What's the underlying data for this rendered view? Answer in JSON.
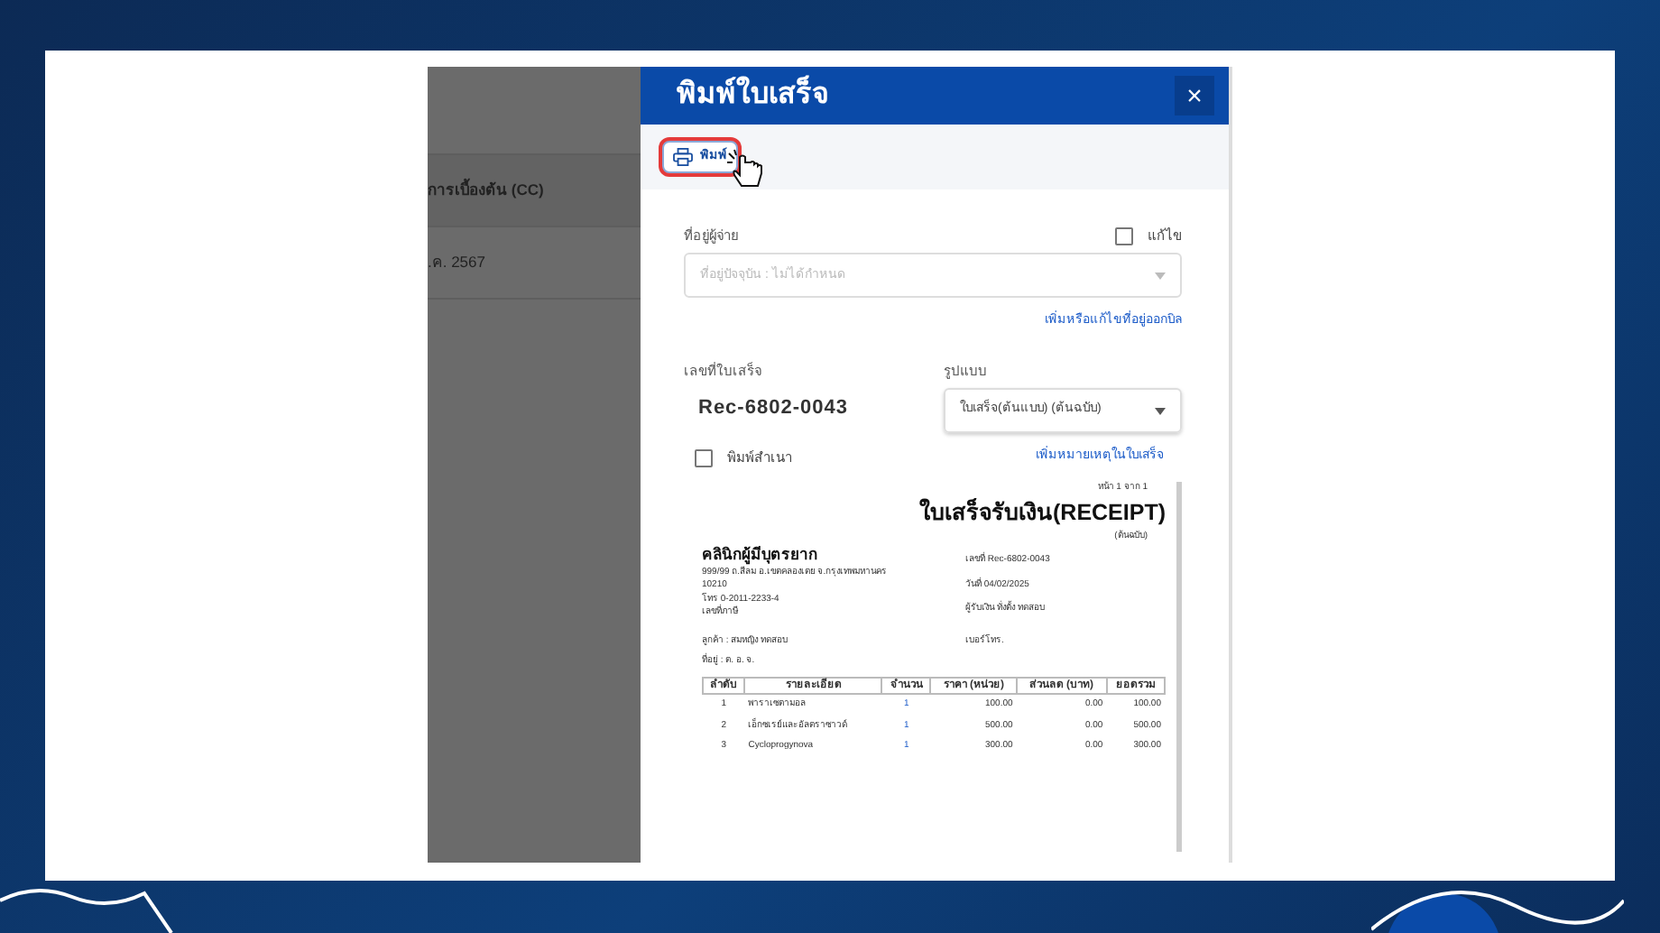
{
  "background_app": {
    "rows": [
      {
        "text": "การเบื้องต้น (CC)",
        "bold": true
      },
      {
        "text": ".ค. 2567",
        "bold": false
      }
    ]
  },
  "dialog": {
    "title": "พิมพ์ใบเสร็จ",
    "close": "×",
    "print_button": "พิมพ์",
    "payer_address": {
      "label": "ที่อยู่ผู้จ่าย",
      "edit": {
        "label": "แก้ไข",
        "checked": false
      },
      "placeholder": "ที่อยู่ปัจจุบัน : ไม่ได้กำหนด",
      "link": "เพิ่มหรือแก้ไขที่อยู่ออกบิล"
    },
    "receipt_no": {
      "label": "เลขที่ใบเสร็จ",
      "value": "Rec-6802-0043"
    },
    "format": {
      "label": "รูปแบบ",
      "value": "ใบเสร็จ(ต้นแบบ) (ต้นฉบับ)"
    },
    "print_copy": {
      "label": "พิมพ์สำเนา",
      "checked": false
    },
    "note_link": "เพิ่มหมายเหตุในใบเสร็จ",
    "preview": {
      "page": "หน้า 1 จาก 1",
      "title": "ใบเสร็จรับเงิน(RECEIPT)",
      "subtitle": "(ต้นฉบับ)",
      "clinic": "คลินิกผู้มีบุตรยาก",
      "address_lines": [
        "999/99 ถ.สีลม อ.เขตคลองเตย จ.กรุงเทพมหานคร",
        "10210",
        "โทร 0-2011-2233-4",
        "เลขที่ภาษี"
      ],
      "meta": [
        "เลขที่ Rec-6802-0043",
        "วันที่ 04/02/2025",
        "ผู้รับเงิน ทั่งตั้ง ทดสอบ"
      ],
      "customer": "ลูกค้า :  สมหญิง ทดสอบ",
      "phone": "เบอร์โทร.",
      "address": "ที่อยู่ :   ต. อ. จ.",
      "columns": [
        "ลำดับ",
        "รายละเอียด",
        "จำนวน",
        "ราคา (หน่วย)",
        "ส่วนลด (บาท)",
        "ยอดรวม"
      ],
      "rows": [
        [
          "1",
          "พาราเซตามอล",
          "1",
          "100.00",
          "0.00",
          "100.00"
        ],
        [
          "2",
          "เอ็กซเรย์และอัลตราซาวด์",
          "1",
          "500.00",
          "0.00",
          "500.00"
        ],
        [
          "3",
          "Cycloprogynova",
          "1",
          "300.00",
          "0.00",
          "300.00"
        ]
      ]
    }
  }
}
